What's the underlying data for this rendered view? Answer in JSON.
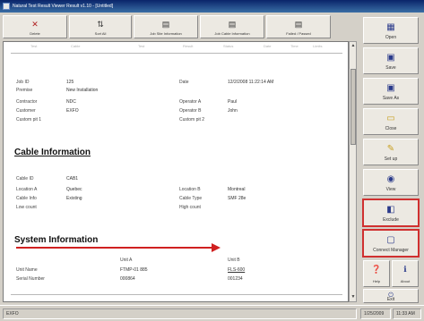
{
  "window": {
    "title": "Natural Test Result Viewer Result v1.10 - [Untitled]"
  },
  "toolbar": {
    "buttons": [
      {
        "label": "Delete",
        "icon": "delete-x-icon"
      },
      {
        "label": "Sort All",
        "icon": "sort-icon"
      },
      {
        "label": "Job Site Information",
        "icon": "doc-icon"
      },
      {
        "label": "Job Cable Information",
        "icon": "doc-icon"
      },
      {
        "label": "Failed / Passed",
        "icon": "doc-icon"
      }
    ]
  },
  "report": {
    "column_headers": [
      "Test",
      "Cable",
      "Test",
      "Result",
      "Status",
      "Date",
      "Time",
      "Limits"
    ],
    "job": {
      "fields_left": [
        {
          "label": "Job ID",
          "value": "125"
        },
        {
          "label": "Premise",
          "value": "New Installation"
        },
        {
          "label": "Contractor",
          "value": "NDC"
        },
        {
          "label": "Customer",
          "value": "EXFO"
        },
        {
          "label": "Custom pit 1",
          "value": ""
        }
      ],
      "fields_right": [
        {
          "label": "Date",
          "value": "12/2/2008 11:22:14 AM"
        },
        {
          "label": "Operator A",
          "value": "Paul"
        },
        {
          "label": "Operator B",
          "value": "John"
        },
        {
          "label": "Custom pit 2",
          "value": ""
        }
      ]
    },
    "cable": {
      "heading": "Cable Information",
      "fields_left": [
        {
          "label": "Cable ID",
          "value": "CAB1"
        },
        {
          "label": "Location A",
          "value": "Quebec"
        },
        {
          "label": "Cable Info",
          "value": "Existing"
        },
        {
          "label": "Low count",
          "value": ""
        }
      ],
      "fields_right": [
        {
          "label": "Location B",
          "value": "Montreal"
        },
        {
          "label": "Cable Type",
          "value": "SMF 28e"
        },
        {
          "label": "High count",
          "value": ""
        }
      ]
    },
    "system": {
      "heading": "System Information",
      "unit_a": "Unit A",
      "unit_b": "Unit B",
      "rows": [
        {
          "label": "Unit Name",
          "a": "FTMP-01 885",
          "b": "FLS-600"
        },
        {
          "label": "Serial Number",
          "a": "000864",
          "b": "001234"
        }
      ]
    }
  },
  "sidebar": {
    "buttons": [
      {
        "label": "Open",
        "icon": "open-icon",
        "highlight": false
      },
      {
        "label": "Save",
        "icon": "save-icon",
        "highlight": false
      },
      {
        "label": "Save As",
        "icon": "save-as-icon",
        "highlight": false
      },
      {
        "label": "Close",
        "icon": "close-folder-icon",
        "highlight": false
      },
      {
        "label": "Set up",
        "icon": "setup-icon",
        "highlight": false
      },
      {
        "label": "View",
        "icon": "view-icon",
        "highlight": false
      },
      {
        "label": "Exclude",
        "icon": "exclude-icon",
        "highlight": true
      },
      {
        "label": "Connect Manager",
        "icon": "connect-icon",
        "highlight": true
      }
    ],
    "help_label": "Help",
    "about_label": "About",
    "exit_label": "Exit"
  },
  "statusbar": {
    "left": "EXFO",
    "date": "1/25/2009",
    "time": "11:33 AM"
  },
  "colors": {
    "accent": "#0a246a",
    "highlight": "#d03030",
    "arrow": "#d02020"
  }
}
